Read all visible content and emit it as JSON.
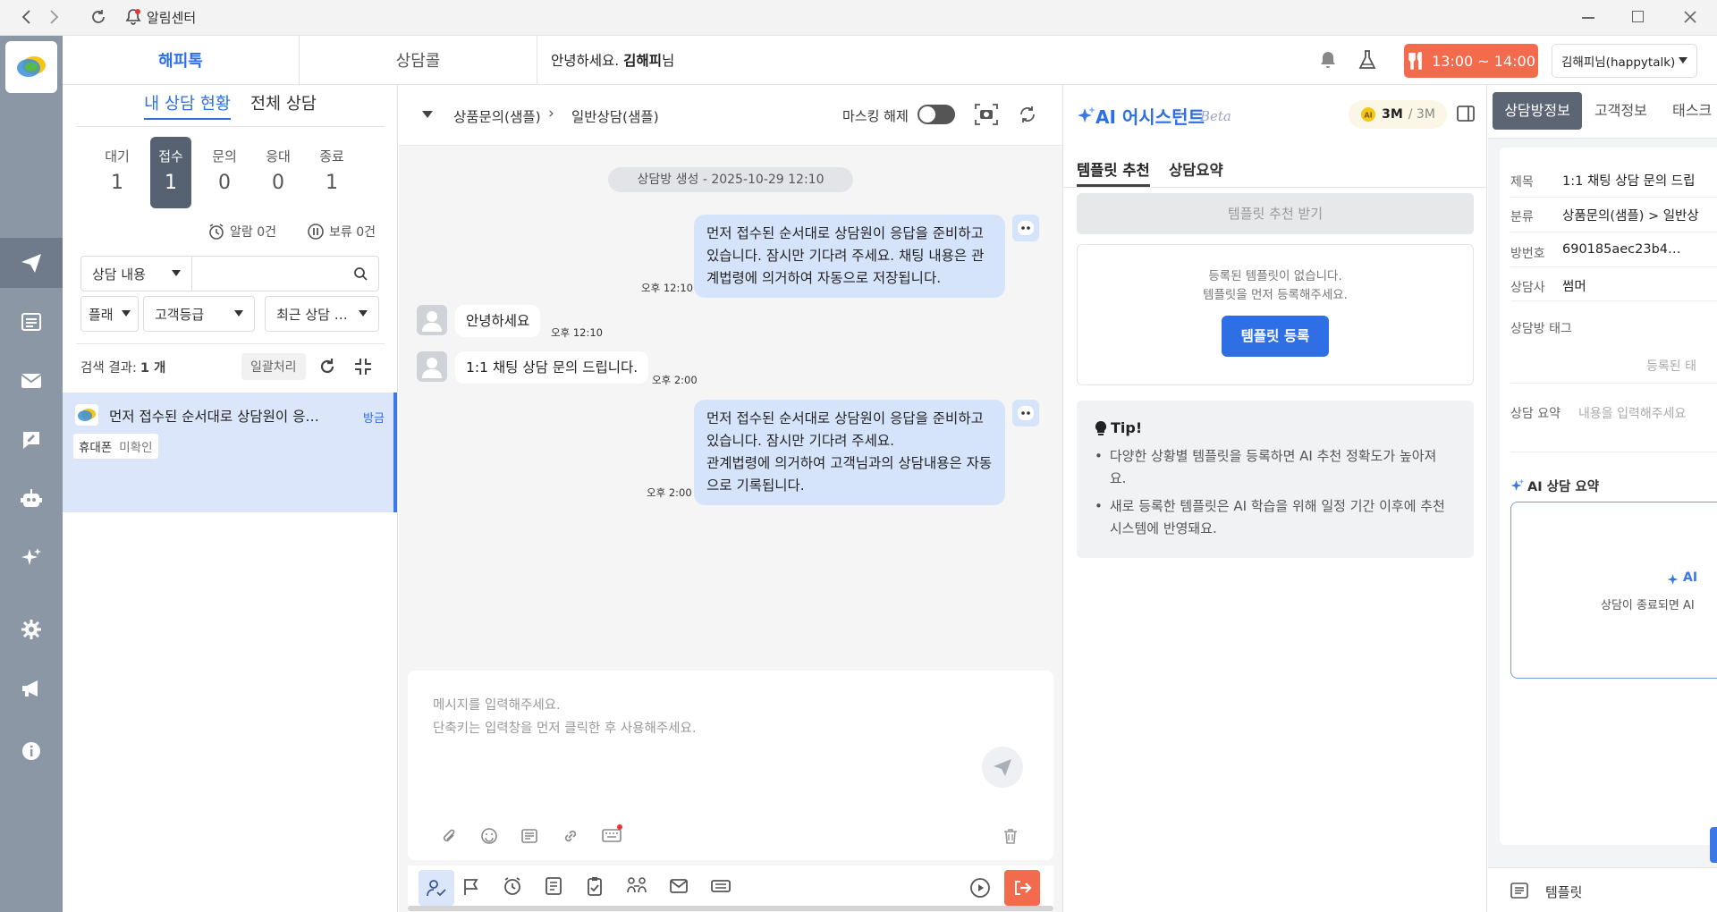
{
  "titlebar": {
    "title": "알림센터"
  },
  "top": {
    "tab_happytalk": "해피톡",
    "tab_call": "상담콜",
    "greeting": "안녕하세요.",
    "greeting_name": "김해피",
    "greeting_suffix": "님",
    "break_time": "13:00 ~ 14:00",
    "user_label": "김해피님(happytalk)"
  },
  "left": {
    "tab_mine": "내 상담 현황",
    "tab_all": "전체 상담",
    "stats": [
      {
        "label": "대기",
        "count": "1"
      },
      {
        "label": "접수",
        "count": "1"
      },
      {
        "label": "문의",
        "count": "0"
      },
      {
        "label": "응대",
        "count": "0"
      },
      {
        "label": "종료",
        "count": "1"
      }
    ],
    "alarm": "알람 0건",
    "hold": "보류 0건",
    "filter_content": "상담 내용",
    "filter_platform": "플래",
    "filter_grade": "고객등급",
    "filter_recent": "최근 상담 …",
    "results_label": "검색 결과:",
    "results_count": "1 개",
    "bulk": "일괄처리",
    "item_text": "먼저 접수된 순서대로 상담원이 응…",
    "item_time": "방금",
    "item_tag": "휴대폰",
    "item_tag2": "미확인"
  },
  "chat": {
    "crumb1": "상품문의(샘플)",
    "crumb2": "일반상담(샘플)",
    "mask": "마스킹 해제",
    "created": "상담방 생성 - 2025-10-29 12:10",
    "msg1": "먼저 접수된 순서대로 상담원이 응답을 준비하고 있습니다. 잠시만 기다려 주세요. 채팅 내용은 관계법령에 의거하여 자동으로 저장됩니다.",
    "msg1_time": "오후 12:10",
    "msg2": "안녕하세요",
    "msg2_time": "오후 12:10",
    "msg3": "1:1 채팅 상담 문의 드립니다.",
    "msg3_time": "오후 2:00",
    "msg4": "먼저 접수된 순서대로 상담원이 응답을 준비하고 있습니다. 잠시만 기다려 주세요.",
    "msg4b": "관계법령에 의거하여 고객님과의 상담내용은 자동으로 기록됩니다.",
    "msg4_time": "오후 2:00",
    "placeholder1": "메시지를 입력해주세요.",
    "placeholder2": "단축키는 입력창을 먼저 클릭한 후 사용해주세요."
  },
  "ai": {
    "title": "AI 어시스턴트",
    "beta": "Beta",
    "quota": "3M",
    "quota_total": "/ 3M",
    "tab_template": "템플릿 추천",
    "tab_summary": "상담요약",
    "get_btn": "템플릿 추천 받기",
    "empty1": "등록된 템플릿이 없습니다.",
    "empty2": "템플릿을 먼저 등록해주세요.",
    "register_btn": "템플릿 등록",
    "tip_title": "Tip!",
    "tip1": "다양한 상황별 템플릿을 등록하면 AI 추천 정확도가 높아져요.",
    "tip2": "새로 등록한 템플릿은 AI 학습을 위해 일정 기간 이후에 추천 시스템에 반영돼요."
  },
  "info": {
    "tab1": "상담방정보",
    "tab2": "고객정보",
    "tab3": "태스크",
    "r_title_label": "제목",
    "r_title": "1:1 채팅 상담 문의 드립",
    "r_cat_label": "분류",
    "r_cat": "상품문의(샘플) > 일반상",
    "r_room_label": "방번호",
    "r_room": "690185aec23b4…",
    "r_agent_label": "상담사",
    "r_agent": "썸머",
    "tag_label": "상담방 태그",
    "tag_empty": "등록된 태",
    "summary_label": "상담 요약",
    "summary_ph": "내용을 입력해주세요",
    "ai_summary": "AI 상담 요약",
    "ai_card_title": "AI",
    "ai_card_text": "상담이 종료되면 AI",
    "template_link": "템플릿"
  },
  "colors": {
    "accent": "#2f6fe6",
    "sidebar": "#8c97a6",
    "break": "#f26b4c",
    "bubble": "#d6e4fb"
  }
}
